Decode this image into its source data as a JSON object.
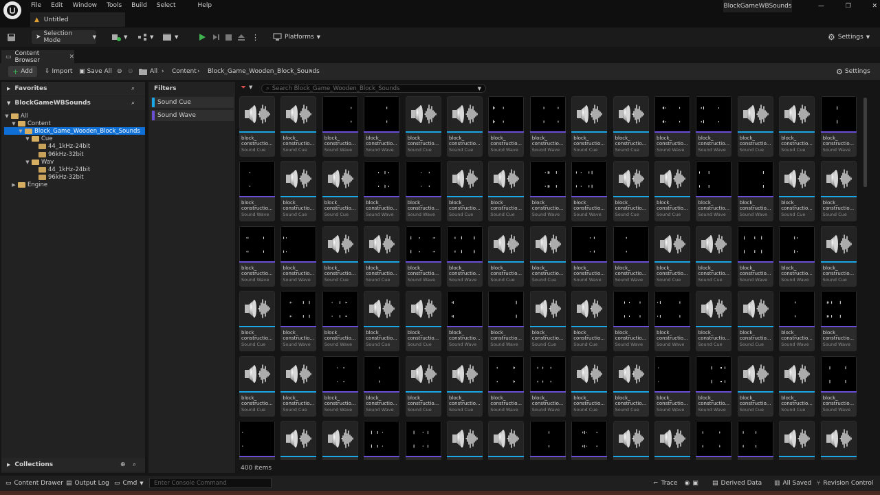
{
  "titlebar": {
    "menu": [
      "File",
      "Edit",
      "Window",
      "Tools",
      "Build",
      "Select",
      "Help"
    ],
    "document_tab": "Untitled",
    "project_name": "BlockGameWBSounds"
  },
  "toolbar": {
    "selection_mode": "Selection Mode",
    "platforms": "Platforms",
    "settings": "Settings"
  },
  "content_browser": {
    "tab_label": "Content Browser",
    "add": "Add",
    "import": "Import",
    "save_all": "Save All",
    "breadcrumb": [
      "All",
      "Content",
      "Block_Game_Wooden_Block_Sounds"
    ],
    "settings": "Settings",
    "search_placeholder": "Search Block_Game_Wooden_Block_Sounds",
    "item_count": "400 items"
  },
  "sources": {
    "favorites": "Favorites",
    "project": "BlockGameWBSounds",
    "collections": "Collections",
    "tree": [
      {
        "label": "All",
        "depth": 0,
        "selected": false
      },
      {
        "label": "Content",
        "depth": 1,
        "selected": false
      },
      {
        "label": "Block_Game_Wooden_Block_Sounds",
        "depth": 2,
        "selected": true
      },
      {
        "label": "Cue",
        "depth": 3,
        "selected": false
      },
      {
        "label": "44_1kHz-24bit",
        "depth": 4,
        "selected": false
      },
      {
        "label": "96kHz-32bit",
        "depth": 4,
        "selected": false
      },
      {
        "label": "Wav",
        "depth": 3,
        "selected": false
      },
      {
        "label": "44_1kHz-24bit",
        "depth": 4,
        "selected": false
      },
      {
        "label": "96kHz-32bit",
        "depth": 4,
        "selected": false
      },
      {
        "label": "Engine",
        "depth": 1,
        "selected": false
      }
    ]
  },
  "filters": {
    "title": "Filters",
    "items": [
      {
        "label": "Sound Cue",
        "color": "#1aa7e8"
      },
      {
        "label": "Sound Wave",
        "color": "#6a4fd6"
      }
    ]
  },
  "asset_labels": {
    "name_line1": "block_",
    "name_line2": "constructio...",
    "cue_type": "Sound Cue",
    "wave_type": "Sound Wave"
  },
  "asset_rows": [
    "CCWWCCWWCCWWCCW",
    "WCCWWCCWWCCWWCC",
    "WWCCWWCCWWCCWWC",
    "CWWCCWWCCWWCCWW",
    "CCWWCCWWCCWWCCW",
    "WCCWWCCWWCCWWCC"
  ],
  "colors": {
    "cue_accent": "#1aa7e8",
    "wave_accent": "#6a4fd6",
    "selection": "#0e6fd6",
    "play_green": "#3fb34f"
  },
  "statusbar": {
    "content_drawer": "Content Drawer",
    "output_log": "Output Log",
    "cmd": "Cmd",
    "console_placeholder": "Enter Console Command",
    "trace": "Trace",
    "derived_data": "Derived Data",
    "all_saved": "All Saved",
    "revision_control": "Revision Control"
  }
}
